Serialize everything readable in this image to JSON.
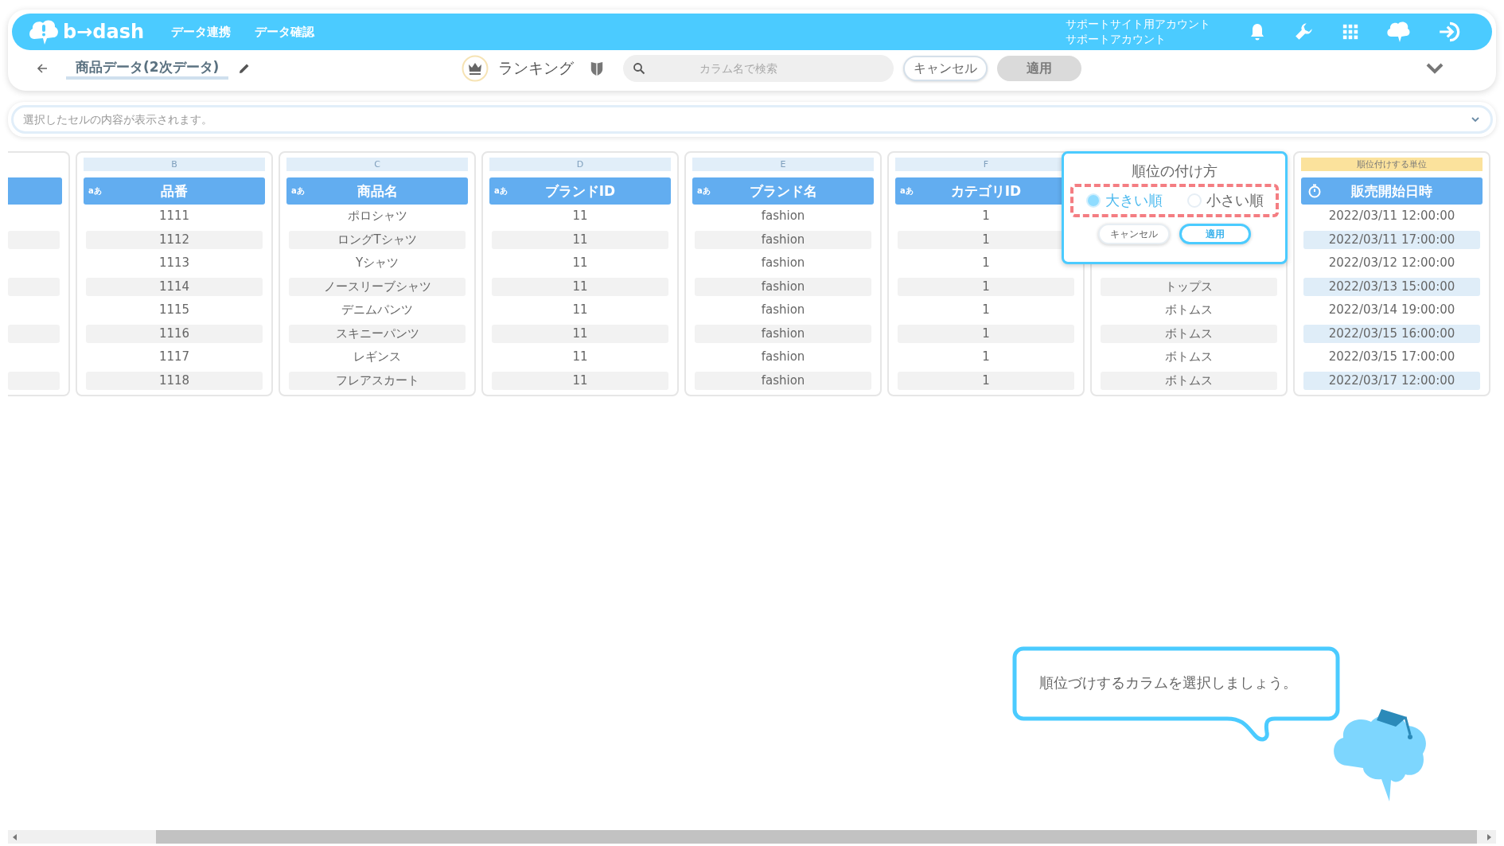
{
  "header": {
    "logo_text": "b→dash",
    "nav": [
      {
        "label": "データ連携"
      },
      {
        "label": "データ確認"
      }
    ],
    "account": [
      "サポートサイト用アカウント",
      "サポートアカウント"
    ]
  },
  "toolbar": {
    "title": "商品データ(2次データ)",
    "mode_label": "ランキング",
    "search": {
      "placeholder": "カラム名で検索"
    },
    "buttons": [
      {
        "label": "キャンセル",
        "disabled": false
      },
      {
        "label": "適用",
        "disabled": true
      }
    ]
  },
  "cell_preview": {
    "placeholder": "選択したセルの内容が表示されます。"
  },
  "columns": [
    {
      "letter": "B",
      "kind": "text",
      "type_label": "aあ",
      "title": "品番",
      "selected": false,
      "cells": [
        "1111",
        "1112",
        "1113",
        "1114",
        "1115",
        "1116",
        "1117",
        "1118"
      ]
    },
    {
      "letter": "C",
      "kind": "text",
      "type_label": "aあ",
      "title": "商品名",
      "selected": false,
      "cells": [
        "ポロシャツ",
        "ロングTシャツ",
        "Yシャツ",
        "ノースリーブシャツ",
        "デニムパンツ",
        "スキニーパンツ",
        "レギンス",
        "フレアスカート"
      ]
    },
    {
      "letter": "D",
      "kind": "text",
      "type_label": "aあ",
      "title": "ブランドID",
      "selected": false,
      "cells": [
        "11",
        "11",
        "11",
        "11",
        "11",
        "11",
        "11",
        "11"
      ]
    },
    {
      "letter": "E",
      "kind": "text",
      "type_label": "aあ",
      "title": "ブランド名",
      "selected": false,
      "cells": [
        "fashion",
        "fashion",
        "fashion",
        "fashion",
        "fashion",
        "fashion",
        "fashion",
        "fashion"
      ]
    },
    {
      "letter": "F",
      "kind": "text",
      "type_label": "aあ",
      "title": "カテゴリID",
      "selected": false,
      "cells": [
        "1",
        "1",
        "1",
        "1",
        "1",
        "1",
        "1",
        "1"
      ]
    },
    {
      "selected": false,
      "cells": [
        "トップス",
        "ボトムス",
        "ボトムス",
        "ボトムス",
        "ボトムス"
      ]
    },
    {
      "unit_label": "順位付けする単位",
      "kind": "datetime",
      "title": "販売開始日時",
      "selected": true,
      "cells": [
        "2022/03/11 12:00:00",
        "2022/03/11 17:00:00",
        "2022/03/12 12:00:00",
        "2022/03/13 15:00:00",
        "2022/03/14 19:00:00",
        "2022/03/15 16:00:00",
        "2022/03/15 17:00:00",
        "2022/03/17 12:00:00"
      ]
    }
  ],
  "ranking_popover": {
    "title": "順位の付け方",
    "options": [
      {
        "label": "大きい順",
        "selected": true
      },
      {
        "label": "小さい順",
        "selected": false
      }
    ],
    "buttons": [
      {
        "label": "キャンセル",
        "kind": "secondary"
      },
      {
        "label": "適用",
        "kind": "primary"
      }
    ]
  },
  "hint": {
    "text": "順位づけするカラムを選択しましょう。"
  }
}
